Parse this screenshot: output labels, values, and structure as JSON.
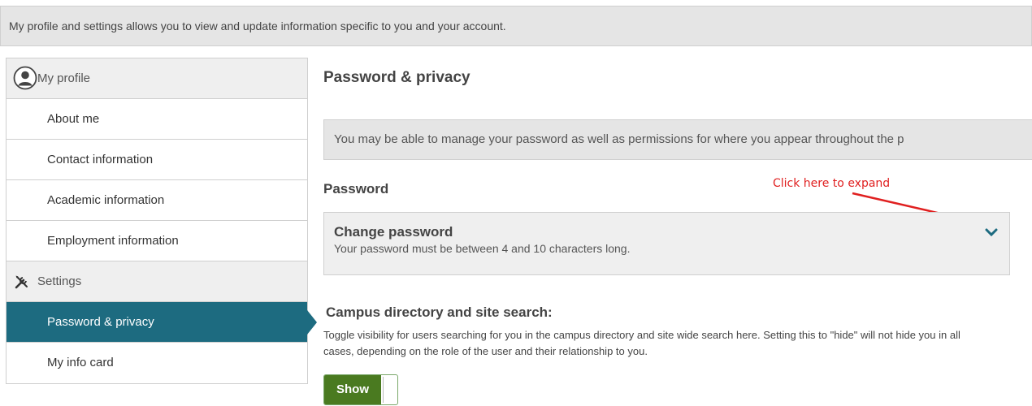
{
  "banner": {
    "text": "My profile and settings allows you to view and update information specific to you and your account."
  },
  "sidebar": {
    "items": [
      {
        "label": "My profile",
        "type": "header",
        "icon": "user-circle-icon"
      },
      {
        "label": "About me",
        "type": "link"
      },
      {
        "label": "Contact information",
        "type": "link"
      },
      {
        "label": "Academic information",
        "type": "link"
      },
      {
        "label": "Employment information",
        "type": "link"
      },
      {
        "label": "Settings",
        "type": "header",
        "icon": "wrench-screwdriver-icon"
      },
      {
        "label": "Password & privacy",
        "type": "link",
        "active": true
      },
      {
        "label": "My info card",
        "type": "link"
      }
    ],
    "active_color": "#1d6b80"
  },
  "main": {
    "title": "Password & privacy",
    "info": "You may be able to manage your password as well as permissions for where you appear throughout the p",
    "password_section": {
      "label": "Password",
      "panel_title": "Change password",
      "panel_subtitle": "Your password must be between 4 and 10 characters long.",
      "expand_icon": "chevron-down-icon"
    },
    "annotation": {
      "text": "Click here to expand",
      "color": "#e02020"
    },
    "directory": {
      "title": "Campus directory and site search:",
      "description": "Toggle visibility for users searching for you in the campus directory and site wide search here. Setting this to \"hide\" will not hide you in all cases, depending on the role of the user and their relationship to you.",
      "toggle_label": "Show",
      "toggle_color": "#4a7a20"
    }
  }
}
